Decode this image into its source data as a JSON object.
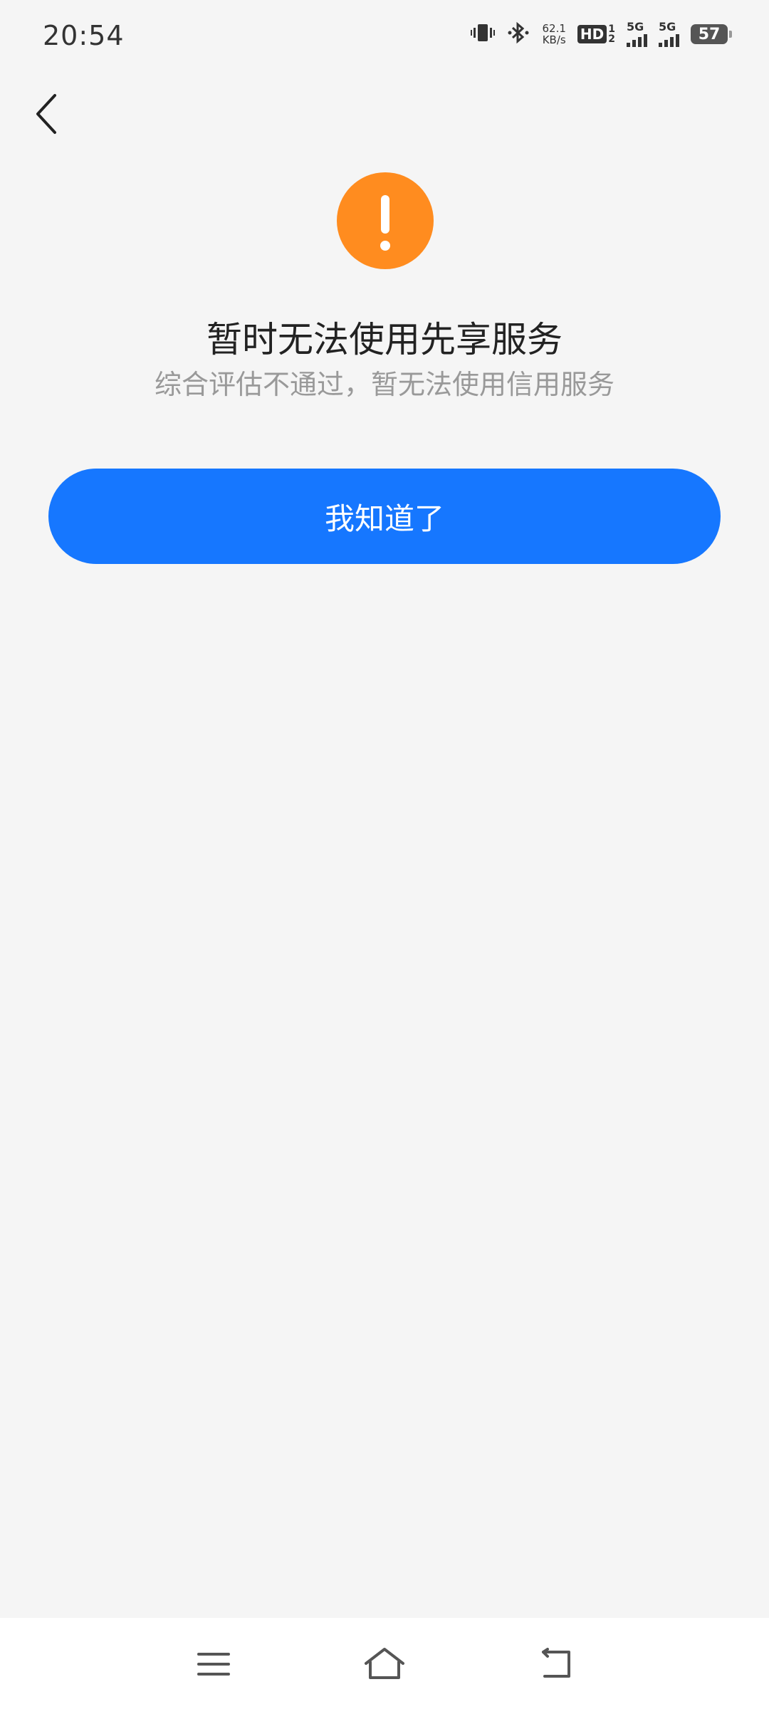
{
  "status_bar": {
    "time": "20:54",
    "net_speed_value": "62.1",
    "net_speed_unit": "KB/s",
    "hd_label": "HD",
    "hd_sub_top": "1",
    "hd_sub_bottom": "2",
    "signal1_label": "5G",
    "signal2_label": "5G",
    "battery": "57",
    "icons": [
      "vibrate-icon",
      "bluetooth-icon",
      "signal-icon",
      "battery-icon"
    ]
  },
  "header": {
    "back_icon": "chevron-left-icon"
  },
  "result": {
    "icon": "warning-icon",
    "icon_color": "#ff8c1f",
    "title": "暂时无法使用先享服务",
    "subtitle": "综合评估不通过，暂无法使用信用服务"
  },
  "actions": {
    "confirm_label": "我知道了",
    "confirm_color": "#1677ff"
  },
  "nav_bar": {
    "items": [
      "menu-icon",
      "home-icon",
      "back-icon"
    ]
  }
}
